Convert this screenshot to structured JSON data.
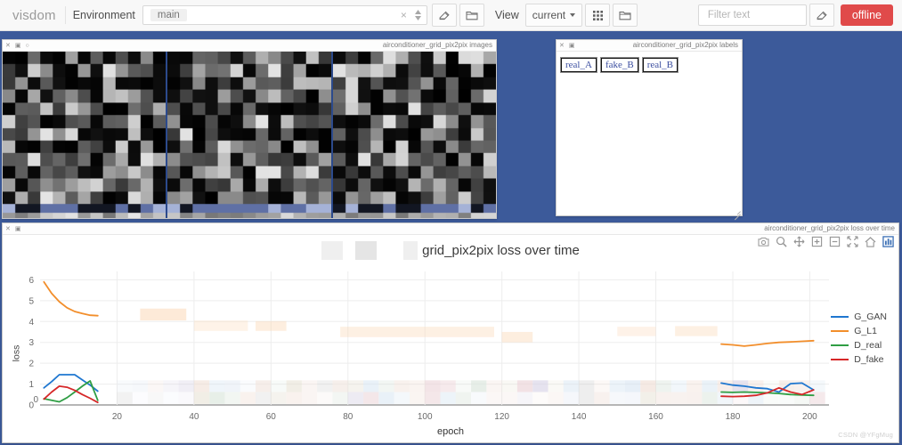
{
  "header": {
    "brand": "visdom",
    "env_label": "Environment",
    "env_selected": "main",
    "env_clear": "×",
    "view_label": "View",
    "view_selected": "current",
    "filter_placeholder": "Filter text",
    "status_button": "offline",
    "icons": {
      "env_eraser": "eraser-icon",
      "env_folder": "folder-icon",
      "view_grid": "grid-icon",
      "view_folder": "folder-icon",
      "filter_eraser": "eraser-icon"
    }
  },
  "panes": {
    "images": {
      "title": "airconditioner_grid_pix2pix images",
      "bar_icons": [
        "close-icon",
        "save-icon",
        "settings-icon"
      ]
    },
    "labels": {
      "title": "airconditioner_grid_pix2pix labels",
      "bar_icons": [
        "close-icon",
        "save-icon"
      ],
      "labels": [
        "real_A",
        "fake_B",
        "real_B"
      ]
    },
    "plot": {
      "title": "airconditioner_grid_pix2pix loss over time",
      "bar_icons": [
        "close-icon",
        "save-icon"
      ],
      "title_icons": [
        "edit-icon",
        "trace-icon"
      ],
      "modebar": [
        "camera-icon",
        "zoom-icon",
        "pan-icon",
        "zoom-in-icon",
        "zoom-out-icon",
        "autoscale-icon",
        "home-icon",
        "toggle-spikelines-icon"
      ]
    }
  },
  "chart_data": {
    "type": "line",
    "title": "grid_pix2pix loss over time",
    "xlabel": "epoch",
    "ylabel": "loss",
    "xlim": [
      0,
      205
    ],
    "ylim": [
      0,
      6.4
    ],
    "xticks": [
      20,
      40,
      60,
      80,
      100,
      120,
      140,
      160,
      180,
      200
    ],
    "yticks": [
      0,
      1,
      2,
      3,
      4,
      5,
      6
    ],
    "grid": true,
    "legend_position": "right",
    "x_left": [
      1,
      3,
      5,
      7,
      9,
      11,
      13,
      15
    ],
    "x_right": [
      177,
      180,
      183,
      186,
      189,
      192,
      195,
      198,
      201
    ],
    "series": [
      {
        "name": "G_GAN",
        "color": "#1f77d0",
        "values_left": [
          0.82,
          1.12,
          1.45,
          1.45,
          1.45,
          1.2,
          0.95,
          0.66
        ],
        "values_right": [
          1.05,
          0.95,
          0.9,
          0.82,
          0.78,
          0.62,
          1.02,
          1.05,
          0.72
        ]
      },
      {
        "name": "G_L1",
        "color": "#f28e2b",
        "values_left": [
          5.9,
          5.35,
          4.95,
          4.66,
          4.48,
          4.38,
          4.3,
          4.28
        ],
        "values_right": [
          2.92,
          2.88,
          2.82,
          2.88,
          2.95,
          3.0,
          3.02,
          3.05,
          3.08
        ]
      },
      {
        "name": "D_real",
        "color": "#2f9e44",
        "values_left": [
          0.3,
          0.22,
          0.15,
          0.35,
          0.62,
          0.9,
          1.15,
          0.22
        ],
        "values_right": [
          0.62,
          0.6,
          0.62,
          0.6,
          0.58,
          0.55,
          0.5,
          0.48,
          0.46
        ]
      },
      {
        "name": "D_fake",
        "color": "#d62728",
        "values_left": [
          0.28,
          0.62,
          0.9,
          0.85,
          0.7,
          0.5,
          0.32,
          0.12
        ],
        "values_right": [
          0.42,
          0.4,
          0.42,
          0.46,
          0.58,
          0.82,
          0.62,
          0.5,
          0.72
        ]
      }
    ]
  },
  "watermark": "CSDN @YFgMug"
}
